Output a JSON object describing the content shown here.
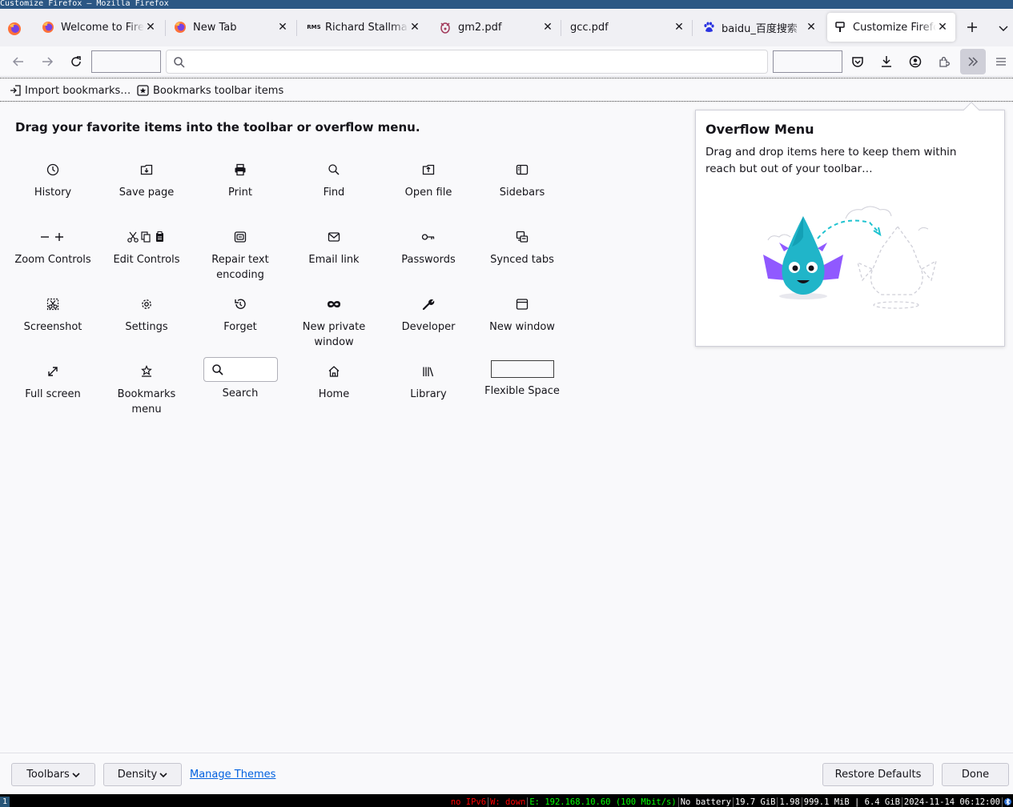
{
  "window": {
    "title": "Customize Firefox — Mozilla Firefox"
  },
  "tabs": [
    {
      "label": "Welcome to Firefox",
      "favicon": "firefox-icon"
    },
    {
      "label": "New Tab",
      "favicon": "firefox-icon"
    },
    {
      "label": "Richard Stallman",
      "favicon": "rms-icon",
      "favicon_text": "RMS"
    },
    {
      "label": "gm2.pdf",
      "favicon": "gnu-icon"
    },
    {
      "label": "gcc.pdf",
      "favicon": ""
    },
    {
      "label": "baidu_百度搜索",
      "favicon": "baidu-paw-icon"
    },
    {
      "label": "Customize Firefox",
      "favicon": "paintbrush-icon",
      "active": true
    }
  ],
  "tab_close_glyph": "✕",
  "bookmarks": {
    "import": "Import bookmarks…",
    "toolbar_items": "Bookmarks toolbar items"
  },
  "palette": {
    "heading": "Drag your favorite items into the toolbar or overflow menu.",
    "items": [
      {
        "label": "History",
        "icon": "clock-icon"
      },
      {
        "label": "Save page",
        "icon": "save-page-icon"
      },
      {
        "label": "Print",
        "icon": "printer-icon"
      },
      {
        "label": "Find",
        "icon": "magnifier-icon"
      },
      {
        "label": "Open file",
        "icon": "open-file-icon"
      },
      {
        "label": "Sidebars",
        "icon": "sidebar-icon"
      },
      {
        "label": "Zoom Controls",
        "icon": "zoom-icon"
      },
      {
        "label": "Edit Controls",
        "icon": "cut-copy-paste-icon"
      },
      {
        "label": "Repair text encoding",
        "icon": "text-encoding-icon"
      },
      {
        "label": "Email link",
        "icon": "envelope-icon"
      },
      {
        "label": "Passwords",
        "icon": "key-icon"
      },
      {
        "label": "Synced tabs",
        "icon": "synced-tabs-icon"
      },
      {
        "label": "Screenshot",
        "icon": "screenshot-icon"
      },
      {
        "label": "Settings",
        "icon": "gear-icon"
      },
      {
        "label": "Forget",
        "icon": "forget-icon"
      },
      {
        "label": "New private window",
        "icon": "mask-icon"
      },
      {
        "label": "Developer",
        "icon": "wrench-icon"
      },
      {
        "label": "New window",
        "icon": "window-icon"
      },
      {
        "label": "Full screen",
        "icon": "fullscreen-icon"
      },
      {
        "label": "Bookmarks menu",
        "icon": "bookmark-star-icon"
      },
      {
        "label": "Search",
        "icon": "search-widget"
      },
      {
        "label": "Home",
        "icon": "home-icon"
      },
      {
        "label": "Library",
        "icon": "library-icon"
      },
      {
        "label": "Flexible Space",
        "icon": "flexible-space-widget"
      }
    ]
  },
  "overflow_panel": {
    "title": "Overflow Menu",
    "description": "Drag and drop items here to keep them within reach but out of your toolbar…"
  },
  "footer": {
    "toolbars": "Toolbars",
    "density": "Density",
    "manage_themes": "Manage Themes",
    "restore_defaults": "Restore Defaults",
    "done": "Done"
  },
  "statusbar": {
    "workspace": "1",
    "ipv6": "no IPv6",
    "wifi": "W: down",
    "ethernet": "E: 192.168.10.60 (100 Mbit/s)",
    "battery": "No battery",
    "disk": "19.7 GiB",
    "load": "1.98",
    "mem": "999.1 MiB | 6.4 GiB",
    "datetime": "2024-11-14 06:12:00"
  },
  "colors": {
    "titlebar": "#2b5784",
    "link": "#0060df",
    "status_red": "#ff0000",
    "status_green": "#00ff00",
    "dragon_body": "#20b5c9",
    "dragon_wings": "#9059ff"
  }
}
